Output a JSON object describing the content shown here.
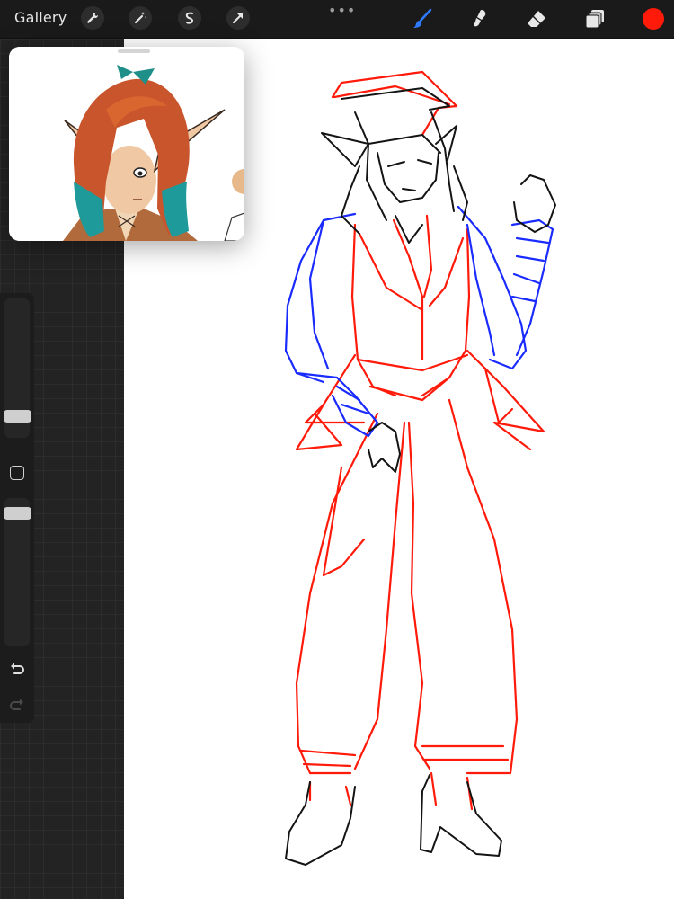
{
  "toolbar": {
    "gallery_label": "Gallery",
    "left_tools": [
      "wrench-icon",
      "magic-wand-icon",
      "selection-icon",
      "transform-arrow-icon"
    ],
    "right_tools": [
      "brush-icon",
      "smudge-icon",
      "eraser-icon",
      "layers-icon"
    ],
    "active_tool": "brush-icon",
    "active_color": "#ff1a0a",
    "accent": "#2f7bff"
  },
  "reference": {
    "window_label": "reference-window"
  },
  "sidebar": {
    "tools": [
      "brush-size-slider",
      "modify-button",
      "opacity-slider",
      "undo-icon",
      "redo-icon"
    ]
  }
}
